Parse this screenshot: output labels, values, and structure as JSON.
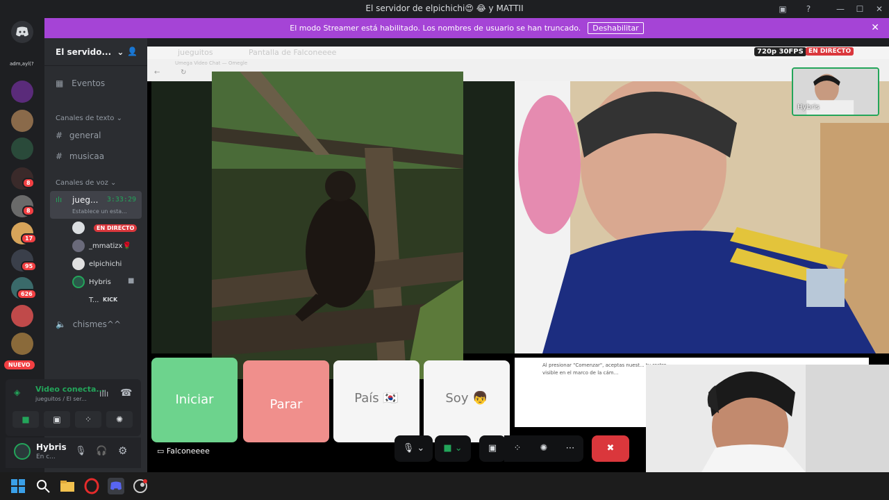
{
  "window": {
    "title": "El servidor de elpichichi😍 😂 y MATTII",
    "title_icon": "discord-user-icon"
  },
  "streamer_bar": {
    "message": "El modo Streamer está habilitado. Los nombres de usuario se han truncado.",
    "button": "Deshabilitar"
  },
  "server_rail": {
    "label_top": "adm,ayl(?",
    "badges": [
      "8",
      "8",
      "17",
      "95",
      "626"
    ],
    "new_label": "NUEVO"
  },
  "sidebar": {
    "server_name": "El servido...",
    "events": "Eventos",
    "text_category": "Canales de texto",
    "text_channels": [
      "general",
      "musicaa"
    ],
    "voice_category": "Canales de voz",
    "voice_channel": {
      "name": "jueg...",
      "timer": "3:33:29",
      "status": "Establece un esta..."
    },
    "members": [
      {
        "name": "",
        "badge": "EN DIRECTO"
      },
      {
        "name": "_mmatizx🌹"
      },
      {
        "name": "elpichichi"
      },
      {
        "name": "Hybris"
      },
      {
        "name": "T...",
        "badge": "KICK"
      }
    ],
    "other_voice": "chismes^^"
  },
  "voice_panel": {
    "title": "Video conecta...",
    "subtitle": "jueguitos / El ser..."
  },
  "user_panel": {
    "name": "Hybris",
    "status": "En c..."
  },
  "stage": {
    "header_left": "jueguitos",
    "header_stream": "Pantalla de Falconeeee",
    "quality": "720p 30FPS",
    "live": "EN DIRECTO",
    "tile_name": "Hybris",
    "stream_name": "Falconeeee",
    "browser_tab": "Umega Video Chat — Omegle",
    "buttons": [
      {
        "label": "Iniciar"
      },
      {
        "label": "Parar"
      },
      {
        "label": "País 🇰🇷"
      },
      {
        "label": "Soy 👦"
      }
    ],
    "notice": "Al presionar \"Comenzar\", aceptas nuest... tu rostro visible en el marco de la cám..."
  },
  "colors": {
    "accent": "#a544d6",
    "discord_blurple": "#5865f2",
    "danger": "#da373c",
    "green": "#23a55a"
  }
}
